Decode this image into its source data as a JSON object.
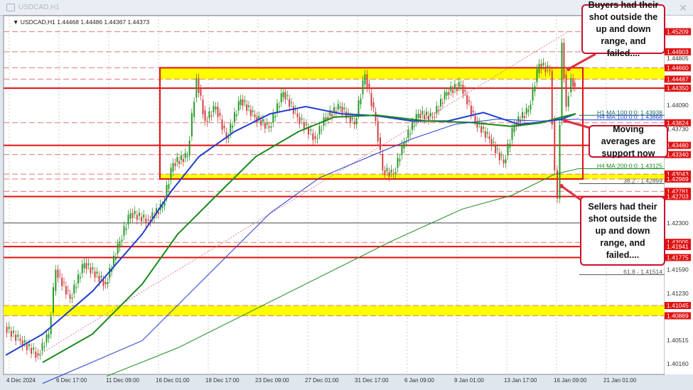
{
  "window": {
    "title": "USDCAD,H1"
  },
  "chart_data": {
    "type": "candlestick",
    "symbol_info": "USDCAD,H1  1.44468 1.44486 1.44367 1.44373",
    "ylim": [
      1.3985,
      1.4545
    ],
    "x_ticks": [
      "4 Dec 2024",
      "6 Dec 17:00",
      "11 Dec 09:00",
      "16 Dec 01:00",
      "18 Dec 17:00",
      "23 Dec 09:00",
      "27 Dec 01:00",
      "31 Dec 17:00",
      "6 Jan 09:00",
      "9 Jan 01:00",
      "13 Jan 17:00",
      "16 Jan 09:00",
      "21 Jan 01:00"
    ],
    "price_path": [
      [
        0,
        1.4072
      ],
      [
        22,
        1.4051
      ],
      [
        47,
        1.4029
      ],
      [
        62,
        1.4061
      ],
      [
        72,
        1.4159
      ],
      [
        92,
        1.4115
      ],
      [
        112,
        1.4169
      ],
      [
        142,
        1.4137
      ],
      [
        162,
        1.4202
      ],
      [
        177,
        1.4245
      ],
      [
        202,
        1.4234
      ],
      [
        222,
        1.4256
      ],
      [
        237,
        1.4321
      ],
      [
        257,
        1.4332
      ],
      [
        270,
        1.445
      ],
      [
        282,
        1.4385
      ],
      [
        297,
        1.4407
      ],
      [
        312,
        1.4358
      ],
      [
        332,
        1.4418
      ],
      [
        352,
        1.4391
      ],
      [
        372,
        1.4375
      ],
      [
        392,
        1.4429
      ],
      [
        412,
        1.4391
      ],
      [
        437,
        1.4358
      ],
      [
        452,
        1.4391
      ],
      [
        472,
        1.4407
      ],
      [
        492,
        1.438
      ],
      [
        507,
        1.4456
      ],
      [
        522,
        1.4385
      ],
      [
        532,
        1.431
      ],
      [
        547,
        1.4304
      ],
      [
        562,
        1.4353
      ],
      [
        582,
        1.4396
      ],
      [
        602,
        1.4391
      ],
      [
        622,
        1.4429
      ],
      [
        642,
        1.444
      ],
      [
        662,
        1.4385
      ],
      [
        682,
        1.4358
      ],
      [
        702,
        1.4321
      ],
      [
        717,
        1.438
      ],
      [
        737,
        1.4402
      ],
      [
        752,
        1.4472
      ],
      [
        767,
        1.4461
      ],
      [
        774,
        1.431
      ],
      [
        778,
        1.4267
      ],
      [
        784,
        1.4504
      ],
      [
        790,
        1.4407
      ],
      [
        797,
        1.445
      ],
      [
        802,
        1.4437
      ]
    ],
    "moving_averages": [
      {
        "name": "H1 MA 100",
        "color": "#1f3fd0",
        "width": 2,
        "points": [
          [
            0,
            1.4029
          ],
          [
            52,
            1.4061
          ],
          [
            122,
            1.4126
          ],
          [
            192,
            1.4213
          ],
          [
            232,
            1.4277
          ],
          [
            272,
            1.4331
          ],
          [
            322,
            1.4369
          ],
          [
            372,
            1.4396
          ],
          [
            422,
            1.4407
          ],
          [
            472,
            1.4396
          ],
          [
            522,
            1.4393
          ],
          [
            572,
            1.4385
          ],
          [
            622,
            1.4385
          ],
          [
            672,
            1.4398
          ],
          [
            722,
            1.438
          ],
          [
            752,
            1.4383
          ],
          [
            782,
            1.4388
          ],
          [
            802,
            1.4396
          ]
        ]
      },
      {
        "name": "H1 MA 200",
        "color": "#1a8a1a",
        "width": 2,
        "points": [
          [
            52,
            1.4018
          ],
          [
            122,
            1.4061
          ],
          [
            192,
            1.4137
          ],
          [
            242,
            1.4213
          ],
          [
            292,
            1.4267
          ],
          [
            352,
            1.4331
          ],
          [
            412,
            1.4369
          ],
          [
            462,
            1.4391
          ],
          [
            522,
            1.4394
          ],
          [
            592,
            1.4385
          ],
          [
            652,
            1.4383
          ],
          [
            712,
            1.4377
          ],
          [
            752,
            1.4382
          ],
          [
            782,
            1.4391
          ],
          [
            802,
            1.4396
          ]
        ]
      },
      {
        "name": "H4 MA 100",
        "color": "#1f3fd0",
        "width": 1,
        "points": [
          [
            52,
            1.3986
          ],
          [
            192,
            1.4051
          ],
          [
            292,
            1.4159
          ],
          [
            372,
            1.4245
          ],
          [
            442,
            1.4299
          ],
          [
            512,
            1.4331
          ],
          [
            572,
            1.4358
          ],
          [
            632,
            1.438
          ],
          [
            692,
            1.4388
          ],
          [
            752,
            1.4385
          ],
          [
            807,
            1.4388
          ]
        ]
      },
      {
        "name": "H4 MA 200",
        "color": "#1a8a1a",
        "width": 1,
        "points": [
          [
            142,
            1.3997
          ],
          [
            242,
            1.404
          ],
          [
            342,
            1.4094
          ],
          [
            442,
            1.4148
          ],
          [
            542,
            1.4202
          ],
          [
            642,
            1.4251
          ],
          [
            712,
            1.4272
          ],
          [
            772,
            1.4304
          ],
          [
            807,
            1.4313
          ]
        ]
      }
    ],
    "axis_plain": [
      "1.44805",
      "1.44090",
      "1.43730",
      "1.42300",
      "1.41590",
      "1.41230",
      "1.40515",
      "1.40160"
    ],
    "axis_red": [
      "1.45209",
      "1.44903",
      "1.44660",
      "1.44487",
      "1.44350",
      "1.43824",
      "1.43480",
      "1.43340",
      "1.43043",
      "1.42969",
      "1.42781",
      "1.42703",
      "1.42005",
      "1.41941",
      "1.41775",
      "1.41045",
      "1.40889"
    ],
    "levels_solid": [
      "1.44350",
      "1.43480",
      "1.42703",
      "1.41941",
      "1.41775"
    ],
    "levels_dashed": [
      "1.45209",
      "1.44903",
      "1.44660",
      "1.44487",
      "1.43824",
      "1.43340",
      "1.43043",
      "1.42969",
      "1.42781",
      "1.42005",
      "1.41045",
      "1.40889"
    ],
    "zones": [
      [
        "1.44487",
        "1.44660",
        "range"
      ],
      [
        "1.42969",
        "1.43043",
        "range"
      ],
      [
        "1.40889",
        "1.41045",
        "full"
      ]
    ],
    "range_box": [
      "1.42969",
      "1.44660"
    ],
    "line_labels": [
      {
        "text": "H1 MA:100:0:0: 1.43938",
        "price": 1.43938,
        "color": "#1a6a6a"
      },
      {
        "text": "H4 MA:100:0:0: 1.43868",
        "price": 1.43868,
        "color": "#1f3fd0"
      },
      {
        "text": "H4 MA:200:0:0: 1.43125",
        "price": 1.43125,
        "color": "#1a8a1a"
      },
      {
        "text": "38.2 - 1.42899",
        "price": 1.42899,
        "color": "#555"
      },
      {
        "text": "61.8 - 1.41514",
        "price": 1.41514,
        "color": "#555"
      }
    ]
  },
  "annotations": {
    "buyers": "Buyers had their shot outside the up and down range, and failed....",
    "ma": "Moving averages are support now",
    "sellers": "Sellers had their shot outside the up and down range, and failed...."
  }
}
